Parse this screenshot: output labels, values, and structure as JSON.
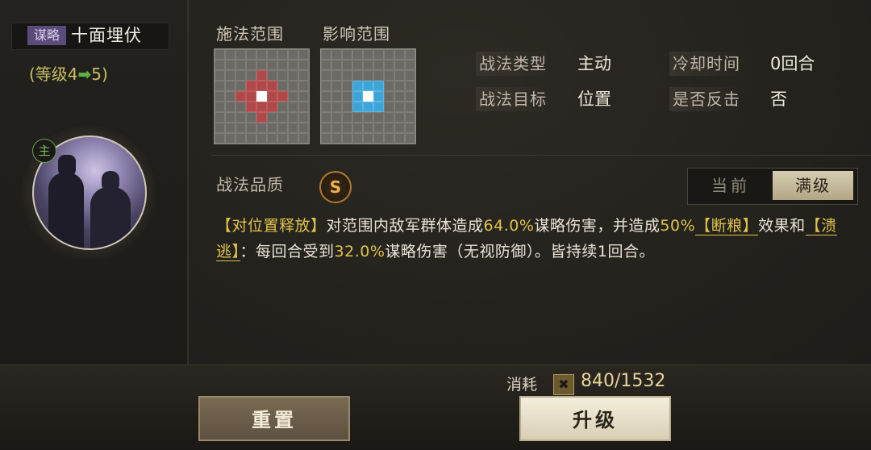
{
  "skill": {
    "type_tag": "谋略",
    "name": "十面埋伏",
    "level_prefix": "(等级4",
    "level_arrow": "➡",
    "level_suffix": "5)",
    "role_badge": "主"
  },
  "ranges": {
    "cast_label": "施法范围",
    "effect_label": "影响范围",
    "grid_size": 9
  },
  "attributes": {
    "type_label": "战法类型",
    "type_value": "主动",
    "cooldown_label": "冷却时间",
    "cooldown_value": "0回合",
    "target_label": "战法目标",
    "target_value": "位置",
    "counter_label": "是否反击",
    "counter_value": "否"
  },
  "quality": {
    "label": "战法品质",
    "grade": "S"
  },
  "toggle": {
    "current": "当前",
    "max": "满级"
  },
  "description": {
    "p1": "【对位置释放】",
    "p2": "对范围内敌军群体造成",
    "p3": "64.0%",
    "p4": "谋略伤害，并造成",
    "p5": "50%",
    "p6": "【断粮】",
    "p7": "效果和",
    "p8": "【溃逃】",
    "p9": "：每回合受到",
    "p10": "32.0%",
    "p11": "谋略伤害（无视防御）。皆持续1回合。"
  },
  "cost": {
    "label": "消耗",
    "icon": "scroll-icon",
    "value": "840/1532"
  },
  "buttons": {
    "reset": "重置",
    "upgrade": "升级"
  },
  "colors": {
    "cast_cell": "#b04a4a",
    "effect_cell": "#3fa4d8",
    "highlight": "#e0c24a"
  }
}
